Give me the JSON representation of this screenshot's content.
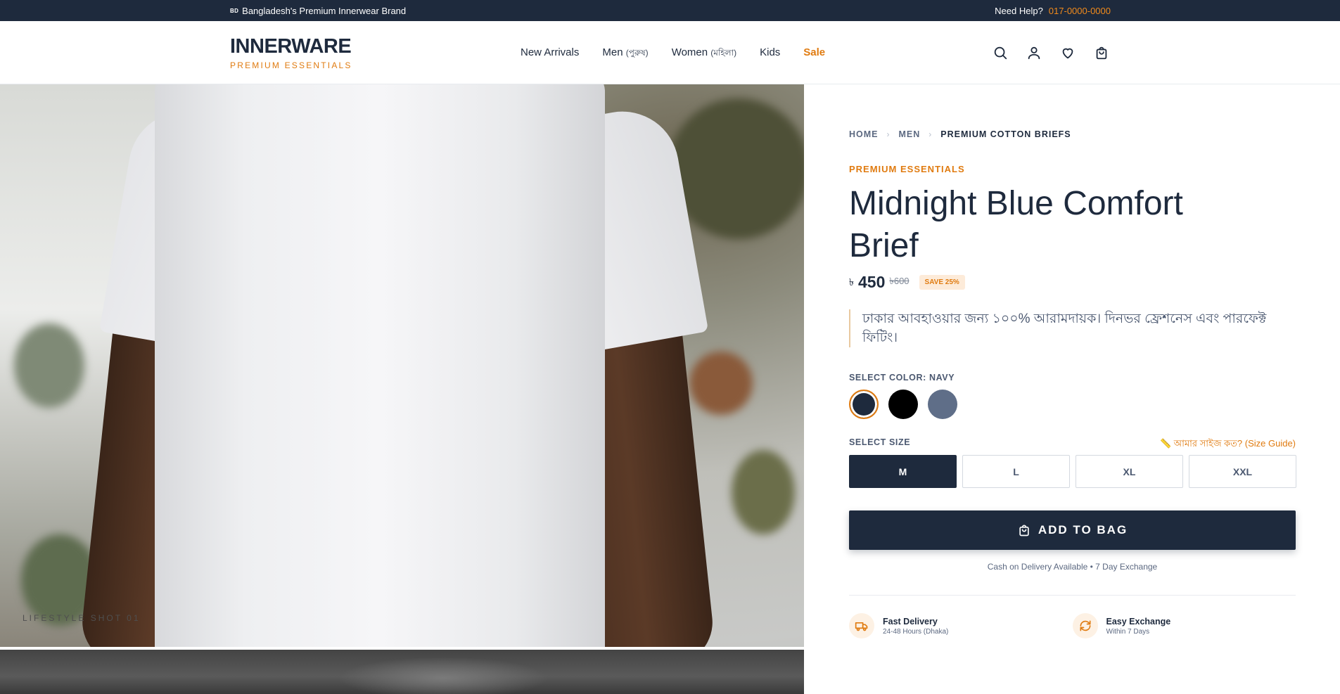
{
  "topbar": {
    "flag": "BD",
    "tagline": "Bangladesh's Premium Innerwear Brand",
    "help_label": "Need Help?",
    "phone": "017-0000-0000"
  },
  "brand": {
    "name": "INNERWARE",
    "tagline": "PREMIUM ESSENTIALS"
  },
  "nav": {
    "items": [
      {
        "label": "New Arrivals",
        "sub": ""
      },
      {
        "label": "Men",
        "sub": "(পুরুষ)"
      },
      {
        "label": "Women",
        "sub": "(মহিলা)"
      },
      {
        "label": "Kids",
        "sub": ""
      },
      {
        "label": "Sale",
        "sub": ""
      }
    ]
  },
  "header_icons": [
    "search-icon",
    "account-icon",
    "wishlist-icon",
    "bag-icon"
  ],
  "gallery": {
    "caption": "LIFESTYLE SHOT 01"
  },
  "product": {
    "breadcrumb": [
      "HOME",
      "MEN",
      "PREMIUM COTTON BRIEFS"
    ],
    "collection": "PREMIUM ESSENTIALS",
    "title": "Midnight Blue Comfort Brief",
    "currency": "৳",
    "price": "450",
    "old_price": "৳600",
    "discount_badge": "SAVE 25%",
    "description": "ঢাকার আবহাওয়ার জন্য ১০০% আরামদায়ক। দিনভর ফ্রেশনেস এবং পারফেক্ট ফিটিং।",
    "color_label": "SELECT COLOR: NAVY",
    "colors": [
      {
        "name": "Navy",
        "hex": "#1e2a3d",
        "selected": true
      },
      {
        "name": "Black",
        "hex": "#000000",
        "selected": false
      },
      {
        "name": "Slate",
        "hex": "#5f6e88",
        "selected": false
      }
    ],
    "size_label": "SELECT SIZE",
    "size_guide": "📏 আমার সাইজ কত? (Size Guide)",
    "sizes": [
      "M",
      "L",
      "XL",
      "XXL"
    ],
    "selected_size": "M",
    "add_to_bag": "ADD TO BAG",
    "note": "Cash on Delivery Available • 7 Day Exchange",
    "features": [
      {
        "icon": "truck-icon",
        "title": "Fast Delivery",
        "subtitle": "24-48 Hours (Dhaka)"
      },
      {
        "icon": "exchange-icon",
        "title": "Easy Exchange",
        "subtitle": "Within 7 Days"
      }
    ]
  },
  "colors": {
    "primary": "#1e2a3d",
    "accent": "#e07b10"
  }
}
